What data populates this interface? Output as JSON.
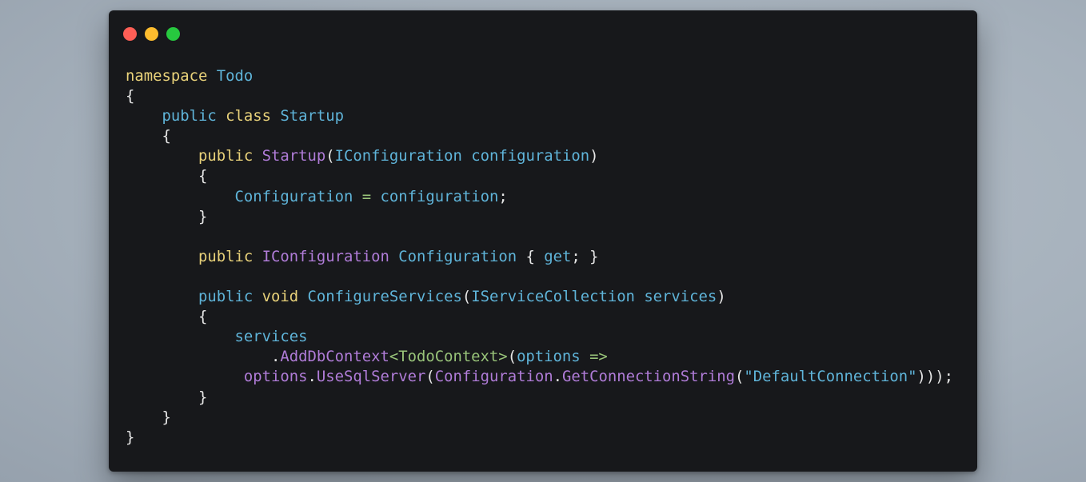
{
  "window": {
    "buttons": [
      {
        "name": "close",
        "color": "#ff5f56"
      },
      {
        "name": "minimize",
        "color": "#ffbd2e"
      },
      {
        "name": "maximize",
        "color": "#27c93f"
      }
    ]
  },
  "colors": {
    "keyword_yellow": "#e9d27a",
    "type_blue": "#5fb4d9",
    "method_purple": "#b07cd8",
    "operator_green": "#98c379",
    "plain": "#e6e6e6"
  },
  "code": {
    "language": "C#",
    "lines": [
      [
        {
          "t": "namespace",
          "c": "keyword_yellow"
        },
        {
          "t": " "
        },
        {
          "t": "Todo",
          "c": "type_blue"
        }
      ],
      [
        {
          "t": "{"
        }
      ],
      [
        {
          "t": "    "
        },
        {
          "t": "public",
          "c": "type_blue"
        },
        {
          "t": " "
        },
        {
          "t": "class",
          "c": "keyword_yellow"
        },
        {
          "t": " "
        },
        {
          "t": "Startup",
          "c": "type_blue"
        }
      ],
      [
        {
          "t": "    {"
        }
      ],
      [
        {
          "t": "        "
        },
        {
          "t": "public",
          "c": "keyword_yellow"
        },
        {
          "t": " "
        },
        {
          "t": "Startup",
          "c": "method_purple"
        },
        {
          "t": "("
        },
        {
          "t": "IConfiguration",
          "c": "type_blue"
        },
        {
          "t": " "
        },
        {
          "t": "configuration",
          "c": "type_blue"
        },
        {
          "t": ")"
        }
      ],
      [
        {
          "t": "        {"
        }
      ],
      [
        {
          "t": "            "
        },
        {
          "t": "Configuration",
          "c": "type_blue"
        },
        {
          "t": " "
        },
        {
          "t": "=",
          "c": "operator_green"
        },
        {
          "t": " "
        },
        {
          "t": "configuration",
          "c": "type_blue"
        },
        {
          "t": ";"
        }
      ],
      [
        {
          "t": "        }"
        }
      ],
      [
        {
          "t": ""
        }
      ],
      [
        {
          "t": "        "
        },
        {
          "t": "public",
          "c": "keyword_yellow"
        },
        {
          "t": " "
        },
        {
          "t": "IConfiguration",
          "c": "method_purple"
        },
        {
          "t": " "
        },
        {
          "t": "Configuration",
          "c": "type_blue"
        },
        {
          "t": " { "
        },
        {
          "t": "get",
          "c": "type_blue"
        },
        {
          "t": "; }"
        }
      ],
      [
        {
          "t": ""
        }
      ],
      [
        {
          "t": "        "
        },
        {
          "t": "public",
          "c": "type_blue"
        },
        {
          "t": " "
        },
        {
          "t": "void",
          "c": "keyword_yellow"
        },
        {
          "t": " "
        },
        {
          "t": "ConfigureServices",
          "c": "type_blue"
        },
        {
          "t": "("
        },
        {
          "t": "IServiceCollection",
          "c": "type_blue"
        },
        {
          "t": " "
        },
        {
          "t": "services",
          "c": "type_blue"
        },
        {
          "t": ")"
        }
      ],
      [
        {
          "t": "        {"
        }
      ],
      [
        {
          "t": "            "
        },
        {
          "t": "services",
          "c": "type_blue"
        }
      ],
      [
        {
          "t": "                ."
        },
        {
          "t": "AddDbContext",
          "c": "method_purple"
        },
        {
          "t": "<TodoContext>",
          "c": "operator_green"
        },
        {
          "t": "("
        },
        {
          "t": "options",
          "c": "type_blue"
        },
        {
          "t": " "
        },
        {
          "t": "=>",
          "c": "operator_green"
        }
      ],
      [
        {
          "t": "             "
        },
        {
          "t": "options",
          "c": "method_purple"
        },
        {
          "t": "."
        },
        {
          "t": "UseSqlServer",
          "c": "method_purple"
        },
        {
          "t": "("
        },
        {
          "t": "Configuration",
          "c": "method_purple"
        },
        {
          "t": "."
        },
        {
          "t": "GetConnectionString",
          "c": "method_purple"
        },
        {
          "t": "("
        },
        {
          "t": "\"DefaultConnection\"",
          "c": "type_blue"
        },
        {
          "t": ")));"
        }
      ],
      [
        {
          "t": "        }"
        }
      ],
      [
        {
          "t": "    }"
        }
      ],
      [
        {
          "t": "}"
        }
      ]
    ]
  }
}
